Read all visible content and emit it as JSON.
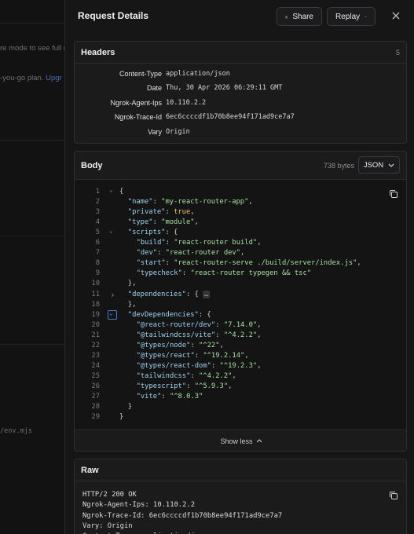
{
  "background": {
    "text1": "re mode to see full r",
    "text2": "-you-go plan.",
    "link": "Upgr",
    "text3": "/env.mjs"
  },
  "drawer": {
    "title": "Request Details",
    "share_label": "Share",
    "replay_label": "Replay",
    "icons": {
      "share": "share-icon",
      "replay_chevron": "chevron-down-icon",
      "close": "close-icon",
      "copy": "copy-icon"
    }
  },
  "headers": {
    "title": "Headers",
    "count": "5",
    "rows": [
      {
        "key": "Content-Type",
        "value": "application/json"
      },
      {
        "key": "Date",
        "value": "Thu, 30 Apr 2026 06:29:11 GMT"
      },
      {
        "key": "Ngrok-Agent-Ips",
        "value": "10.110.2.2"
      },
      {
        "key": "Ngrok-Trace-Id",
        "value": "6ec6ccccdf1b70b8ee94f171ad9ce7a7"
      },
      {
        "key": "Vary",
        "value": "Origin"
      }
    ]
  },
  "body": {
    "title": "Body",
    "size": "738 bytes",
    "format": "JSON",
    "show_less": "Show less",
    "lines": [
      {
        "n": "1",
        "fold": "open",
        "indent": 0,
        "parts": [
          [
            "pn",
            "{"
          ]
        ]
      },
      {
        "n": "2",
        "indent": 1,
        "parts": [
          [
            "key",
            "\"name\""
          ],
          [
            "pn",
            ": "
          ],
          [
            "str",
            "\"my-react-router-app\""
          ],
          [
            "pn",
            ","
          ]
        ]
      },
      {
        "n": "3",
        "indent": 1,
        "parts": [
          [
            "key",
            "\"private\""
          ],
          [
            "pn",
            ": "
          ],
          [
            "kw",
            "true"
          ],
          [
            "pn",
            ","
          ]
        ]
      },
      {
        "n": "4",
        "indent": 1,
        "parts": [
          [
            "key",
            "\"type\""
          ],
          [
            "pn",
            ": "
          ],
          [
            "str",
            "\"module\""
          ],
          [
            "pn",
            ","
          ]
        ]
      },
      {
        "n": "5",
        "fold": "open",
        "indent": 1,
        "parts": [
          [
            "key",
            "\"scripts\""
          ],
          [
            "pn",
            ": {"
          ]
        ]
      },
      {
        "n": "6",
        "indent": 2,
        "parts": [
          [
            "key",
            "\"build\""
          ],
          [
            "pn",
            ": "
          ],
          [
            "str",
            "\"react-router build\""
          ],
          [
            "pn",
            ","
          ]
        ]
      },
      {
        "n": "7",
        "indent": 2,
        "parts": [
          [
            "key",
            "\"dev\""
          ],
          [
            "pn",
            ": "
          ],
          [
            "str",
            "\"react-router dev\""
          ],
          [
            "pn",
            ","
          ]
        ]
      },
      {
        "n": "8",
        "indent": 2,
        "parts": [
          [
            "key",
            "\"start\""
          ],
          [
            "pn",
            ": "
          ],
          [
            "str",
            "\"react-router-serve ./build/server/index.js\""
          ],
          [
            "pn",
            ","
          ]
        ]
      },
      {
        "n": "9",
        "indent": 2,
        "parts": [
          [
            "key",
            "\"typecheck\""
          ],
          [
            "pn",
            ": "
          ],
          [
            "str",
            "\"react-router typegen && tsc\""
          ]
        ]
      },
      {
        "n": "10",
        "indent": 1,
        "parts": [
          [
            "pn",
            "},"
          ]
        ]
      },
      {
        "n": "11",
        "fold": "closed",
        "indent": 1,
        "parts": [
          [
            "key",
            "\"dependencies\""
          ],
          [
            "pn",
            ": { "
          ],
          [
            "ellipsis",
            "…"
          ]
        ]
      },
      {
        "n": "18",
        "indent": 1,
        "parts": [
          [
            "pn",
            "},"
          ]
        ]
      },
      {
        "n": "19",
        "fold": "open-focus",
        "indent": 1,
        "parts": [
          [
            "key",
            "\"devDependencies\""
          ],
          [
            "pn",
            ": {"
          ]
        ]
      },
      {
        "n": "20",
        "indent": 2,
        "parts": [
          [
            "key",
            "\"@react-router/dev\""
          ],
          [
            "pn",
            ": "
          ],
          [
            "str",
            "\"7.14.0\""
          ],
          [
            "pn",
            ","
          ]
        ]
      },
      {
        "n": "21",
        "indent": 2,
        "parts": [
          [
            "key",
            "\"@tailwindcss/vite\""
          ],
          [
            "pn",
            ": "
          ],
          [
            "str",
            "\"^4.2.2\""
          ],
          [
            "pn",
            ","
          ]
        ]
      },
      {
        "n": "22",
        "indent": 2,
        "parts": [
          [
            "key",
            "\"@types/node\""
          ],
          [
            "pn",
            ": "
          ],
          [
            "str",
            "\"^22\""
          ],
          [
            "pn",
            ","
          ]
        ]
      },
      {
        "n": "23",
        "indent": 2,
        "parts": [
          [
            "key",
            "\"@types/react\""
          ],
          [
            "pn",
            ": "
          ],
          [
            "str",
            "\"^19.2.14\""
          ],
          [
            "pn",
            ","
          ]
        ]
      },
      {
        "n": "24",
        "indent": 2,
        "parts": [
          [
            "key",
            "\"@types/react-dom\""
          ],
          [
            "pn",
            ": "
          ],
          [
            "str",
            "\"^19.2.3\""
          ],
          [
            "pn",
            ","
          ]
        ]
      },
      {
        "n": "25",
        "indent": 2,
        "parts": [
          [
            "key",
            "\"tailwindcss\""
          ],
          [
            "pn",
            ": "
          ],
          [
            "str",
            "\"^4.2.2\""
          ],
          [
            "pn",
            ","
          ]
        ]
      },
      {
        "n": "26",
        "indent": 2,
        "parts": [
          [
            "key",
            "\"typescript\""
          ],
          [
            "pn",
            ": "
          ],
          [
            "str",
            "\"^5.9.3\""
          ],
          [
            "pn",
            ","
          ]
        ]
      },
      {
        "n": "27",
        "indent": 2,
        "parts": [
          [
            "key",
            "\"vite\""
          ],
          [
            "pn",
            ": "
          ],
          [
            "str",
            "\"^8.0.3\""
          ]
        ]
      },
      {
        "n": "28",
        "indent": 1,
        "parts": [
          [
            "pn",
            "}"
          ]
        ]
      },
      {
        "n": "29",
        "indent": 0,
        "parts": [
          [
            "pn",
            "}"
          ]
        ]
      }
    ]
  },
  "raw": {
    "title": "Raw",
    "lines": [
      "HTTP/2 200 OK",
      "Ngrok-Agent-Ips: 10.110.2.2",
      "Ngrok-Trace-Id: 6ec6ccccdf1b70b8ee94f171ad9ce7a7",
      "Vary: Origin",
      "Content-Type: application/json"
    ]
  },
  "colors": {
    "background": "#161617",
    "key": "#9dd3ee",
    "string": "#a6e1a0",
    "boolean": "#f1c26a",
    "focus": "#4a78d0"
  }
}
